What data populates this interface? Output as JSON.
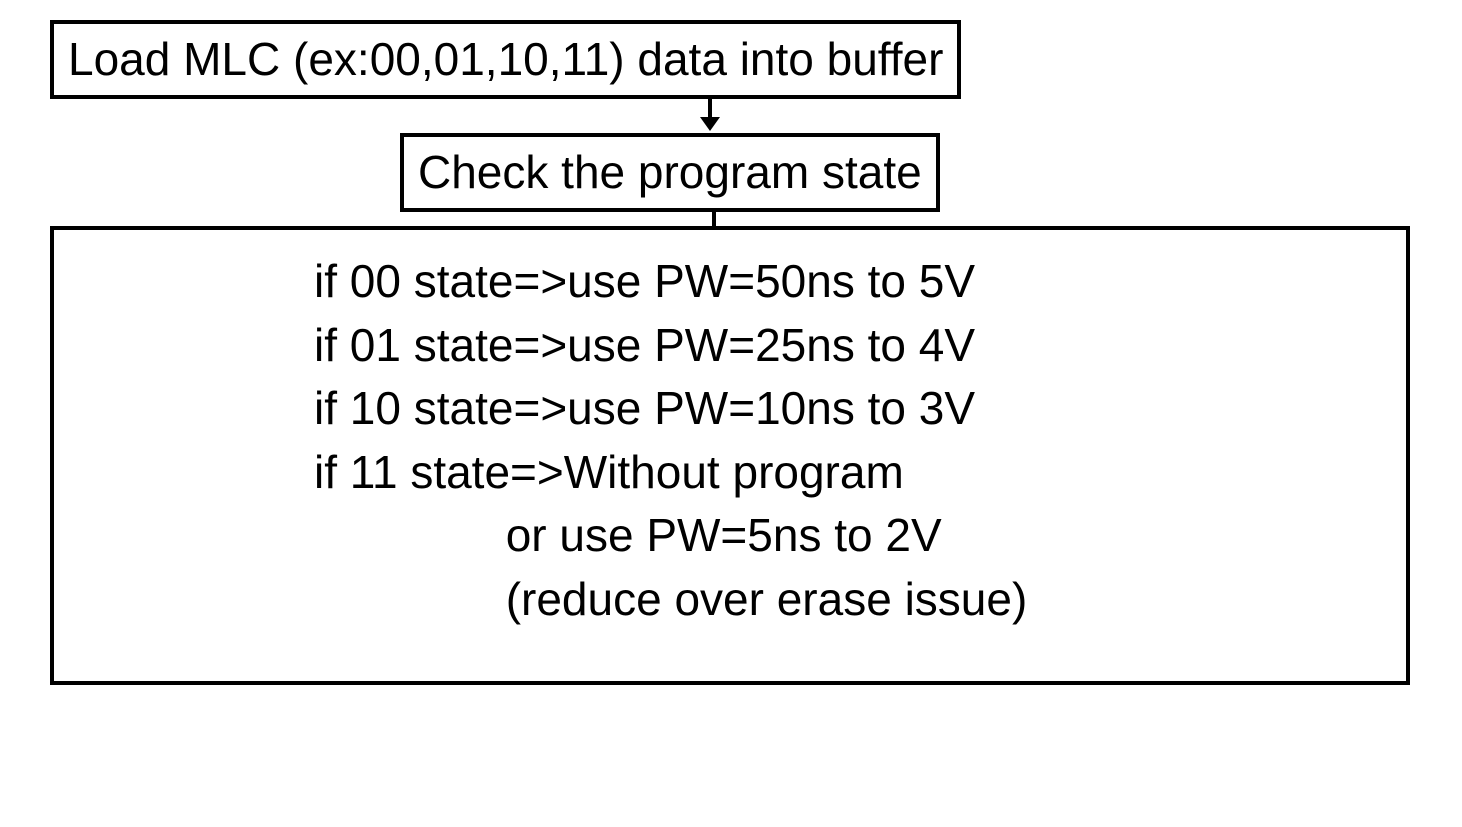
{
  "boxes": {
    "load": "Load MLC (ex:00,01,10,11) data into buffer",
    "check": "Check the program state"
  },
  "rules": {
    "r00": "if 00 state=>use PW=50ns to 5V",
    "r01": "if 01 state=>use PW=25ns to 4V",
    "r10": "if 10 state=>use PW=10ns to 3V",
    "r11a": "if 11 state=>Without program",
    "r11b": "               or use PW=5ns to 2V",
    "r11c": "               (reduce over erase issue)"
  }
}
